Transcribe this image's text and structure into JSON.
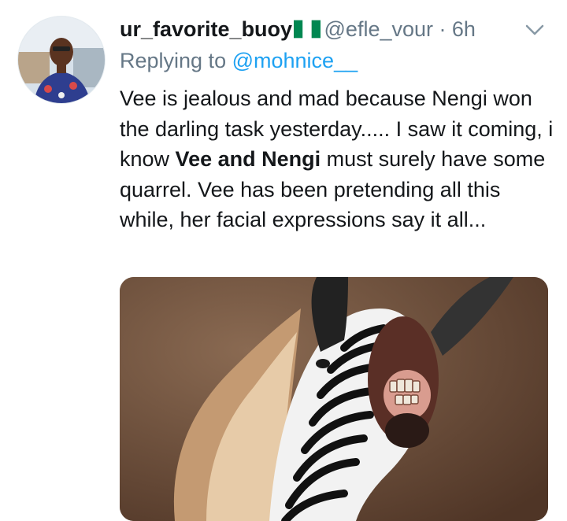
{
  "tweet": {
    "display_name": "ur_favorite_buoy",
    "flag_icon": "nigeria-flag-icon",
    "handle": "@efle_vour",
    "separator": "·",
    "time": "6h",
    "replying_prefix": "Replying to",
    "replying_to": "@mohnice__",
    "text_before": "Vee is jealous and mad because Nengi won the darling task yesterday..... I saw it coming, i know ",
    "text_bold": "Vee and Nengi",
    "text_after": " must surely have some quarrel. Vee has been pretending all this while, her facial expressions say it all..."
  },
  "colors": {
    "text": "#14171a",
    "secondary": "#657786",
    "link": "#1da1f2",
    "flag_green": "#008751",
    "flag_white": "#ffffff"
  }
}
